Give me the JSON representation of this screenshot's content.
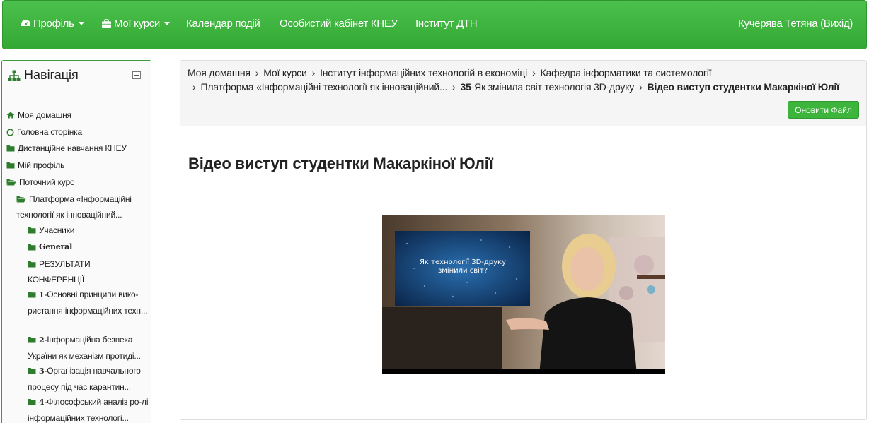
{
  "navbar": {
    "items": [
      {
        "label": "Профіль",
        "icon": "dashboard-icon",
        "dropdown": true
      },
      {
        "label": "Мої курси",
        "icon": "briefcase-icon",
        "dropdown": true
      },
      {
        "label": "Календар подій"
      },
      {
        "label": "Особистий кабінет КНЕУ"
      },
      {
        "label": "Інститут ДТН"
      }
    ],
    "user": "Кучерява Тетяна (Вихід)"
  },
  "navigation": {
    "title": "Навігація",
    "items": [
      {
        "label": "Моя домашня",
        "icon": "home-icon"
      },
      {
        "label": "Головна сторінка",
        "icon": "circle-icon"
      },
      {
        "label": "Дистанційне навчання КНЕУ",
        "icon": "folder-icon"
      },
      {
        "label": "Мій профіль",
        "icon": "folder-icon"
      },
      {
        "label": "Поточний курс",
        "icon": "folder-open-icon"
      },
      {
        "label": "Платформа «Інформаційні технології як інноваційний...",
        "icon": "folder-open-icon"
      },
      {
        "label": "Учасники",
        "icon": "folder-icon"
      },
      {
        "label": "General",
        "icon": "folder-icon"
      },
      {
        "label": "РЕЗУЛЬТАТИ КОНФЕРЕНЦІЇ",
        "icon": "folder-icon"
      },
      {
        "num": "1",
        "label": "-Основні принципи вико-ристання інформаційних техн...",
        "icon": "folder-icon"
      },
      {
        "num": "2",
        "label": "-Інформаційна безпека України як механізм протиді...",
        "icon": "folder-icon"
      },
      {
        "num": "3",
        "label": "-Організація навчального процесу під час карантин...",
        "icon": "folder-icon"
      },
      {
        "num": "4",
        "label": "-Філософський аналіз ро-лі інформаційних технологі...",
        "icon": "folder-icon"
      }
    ]
  },
  "breadcrumb": {
    "items": [
      "Моя домашня",
      "Мої курси",
      "Інститут інформаційних технологій в економіці",
      "Кафедра інформатики та системології",
      "Платформа «Інформаційні технології як інноваційний...",
      "35",
      "-Як змінила світ технологія 3D-друку",
      "Відео виступ студентки Макаркіної Юлії"
    ]
  },
  "update_button": "Оновити Файл",
  "page_title": "Відео виступ студентки Макаркіної Юлії",
  "video": {
    "slide_text_1": "Як технології 3D-друку",
    "slide_text_2": "змінили світ?"
  },
  "colors": {
    "navbar": "#3fb53f",
    "accent": "#3db53d",
    "border": "#3c9a3c"
  }
}
